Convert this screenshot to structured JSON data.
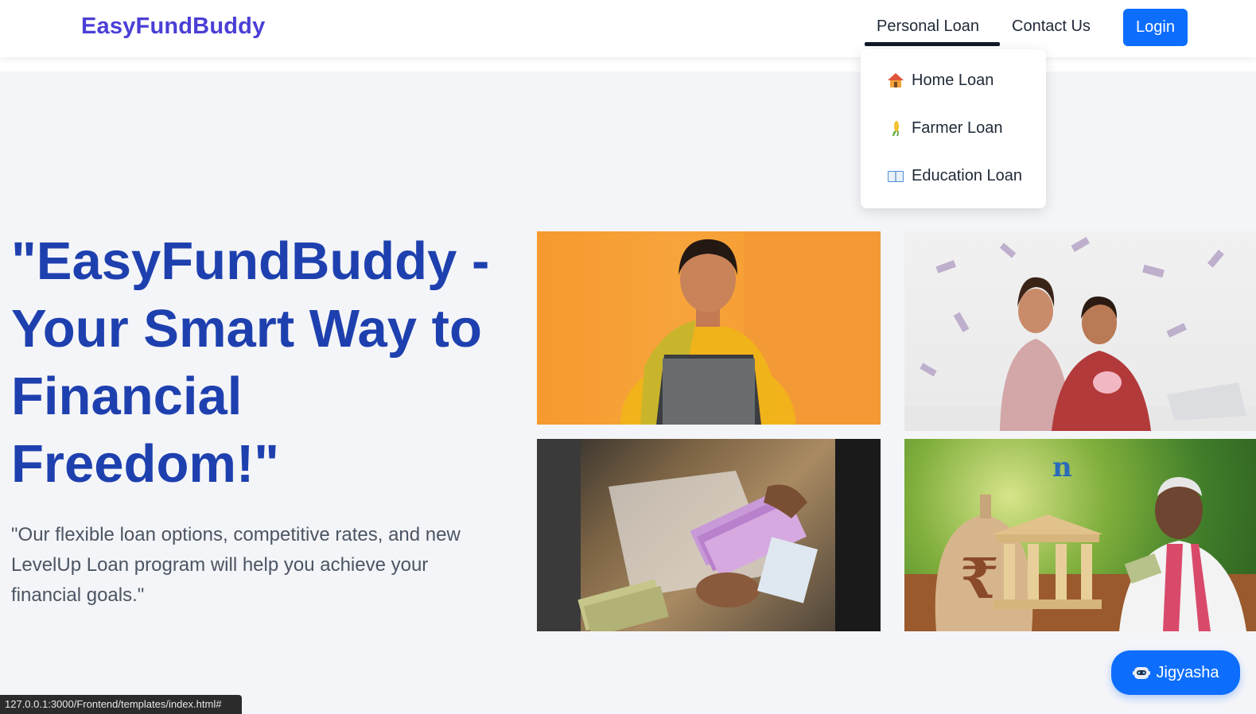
{
  "header": {
    "brand": "EasyFundBuddy",
    "nav": {
      "personal_loan": "Personal Loan",
      "contact_us": "Contact Us",
      "login": "Login"
    }
  },
  "dropdown": {
    "items": [
      {
        "icon": "house-icon",
        "label": "Home Loan"
      },
      {
        "icon": "corn-icon",
        "label": "Farmer Loan"
      },
      {
        "icon": "book-icon",
        "label": "Education Loan"
      }
    ]
  },
  "hero": {
    "title": "\"EasyFundBuddy - Your Smart Way to Financial Freedom!\"",
    "subtitle": "\"Our flexible loan options, competitive rates, and new LevelUp Loan program will help you achieve your financial goals.\""
  },
  "images": {
    "tile4_logo_text": "n"
  },
  "chat": {
    "icon": "robot-icon",
    "label": "Jigyasha"
  },
  "status_bar": {
    "url": "127.0.0.1:3000/Frontend/templates/index.html#"
  },
  "colors": {
    "brand": "#4a3fd6",
    "hero_title": "#1e40af",
    "primary_button": "#0d6efd",
    "page_background": "#f4f5f8"
  }
}
